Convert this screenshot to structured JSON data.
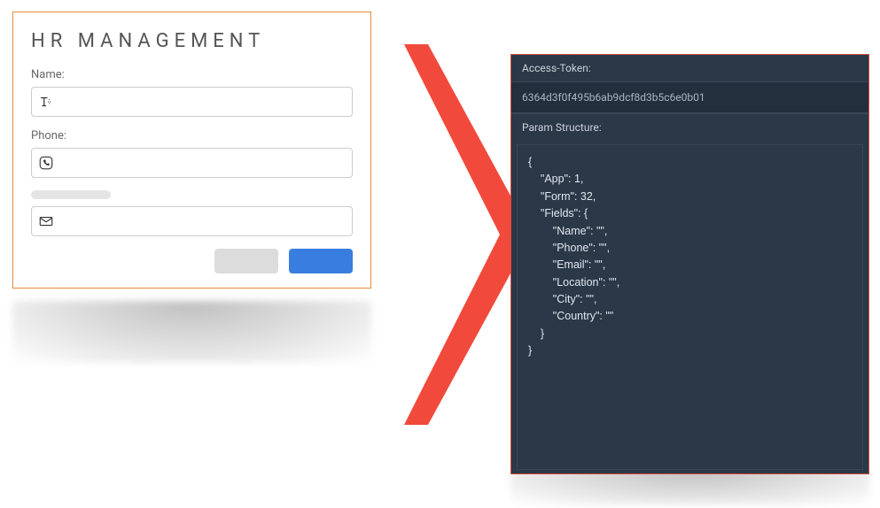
{
  "form": {
    "title": "HR MANAGEMENT",
    "name_label": "Name:",
    "phone_label": "Phone:"
  },
  "api": {
    "token_label": "Access-Token:",
    "token_value": "6364d3f0f495b6ab9dcf8d3b5c6e0b01",
    "struct_label": "Param Structure:",
    "code": "{\n    \"App\": 1,\n    \"Form\": 32,\n    \"Fields\": {\n        \"Name\": \"\",\n        \"Phone\": \"\",\n        \"Email\": \"\",\n        \"Location\": \"\",\n        \"City\": \"\",\n        \"Country\": \"\"\n    }\n}"
  }
}
